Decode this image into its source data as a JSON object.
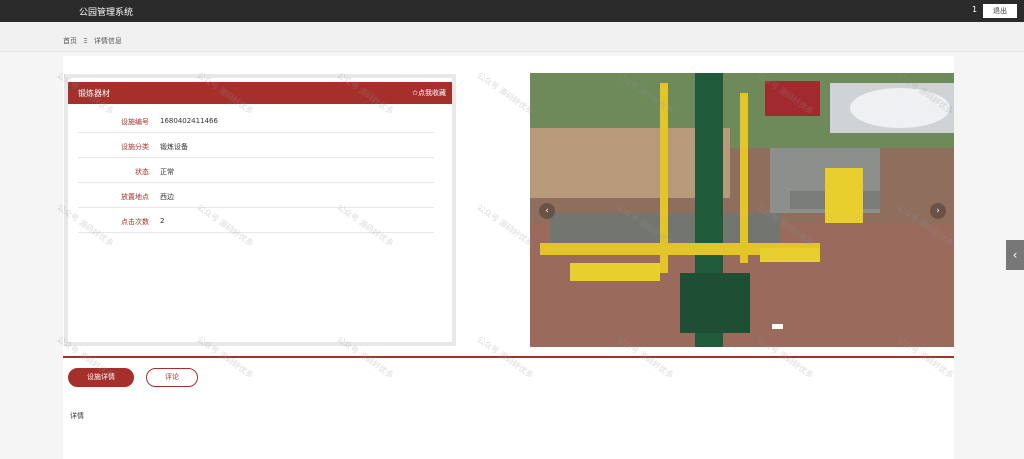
{
  "app": {
    "title": "公园管理系统",
    "user_id": "1",
    "logout_label": "退出"
  },
  "breadcrumb": {
    "home": "首页",
    "separator": "Ξ",
    "current": "详情信息"
  },
  "card": {
    "title": "锻炼器材",
    "favorite_label": "✩点我收藏",
    "fields": [
      {
        "label": "设施编号",
        "value": "1680402411466"
      },
      {
        "label": "设施分类",
        "value": "锻炼设备"
      },
      {
        "label": "状态",
        "value": "正常"
      },
      {
        "label": "放置地点",
        "value": "西边"
      },
      {
        "label": "点击次数",
        "value": "2"
      }
    ]
  },
  "tabs": {
    "detail_label": "设施详情",
    "comment_label": "评论"
  },
  "details": {
    "heading": "详情"
  },
  "watermark": "公众号 源码好优多",
  "colors": {
    "accent": "#a5302b",
    "topbar": "#2b2b2b"
  }
}
